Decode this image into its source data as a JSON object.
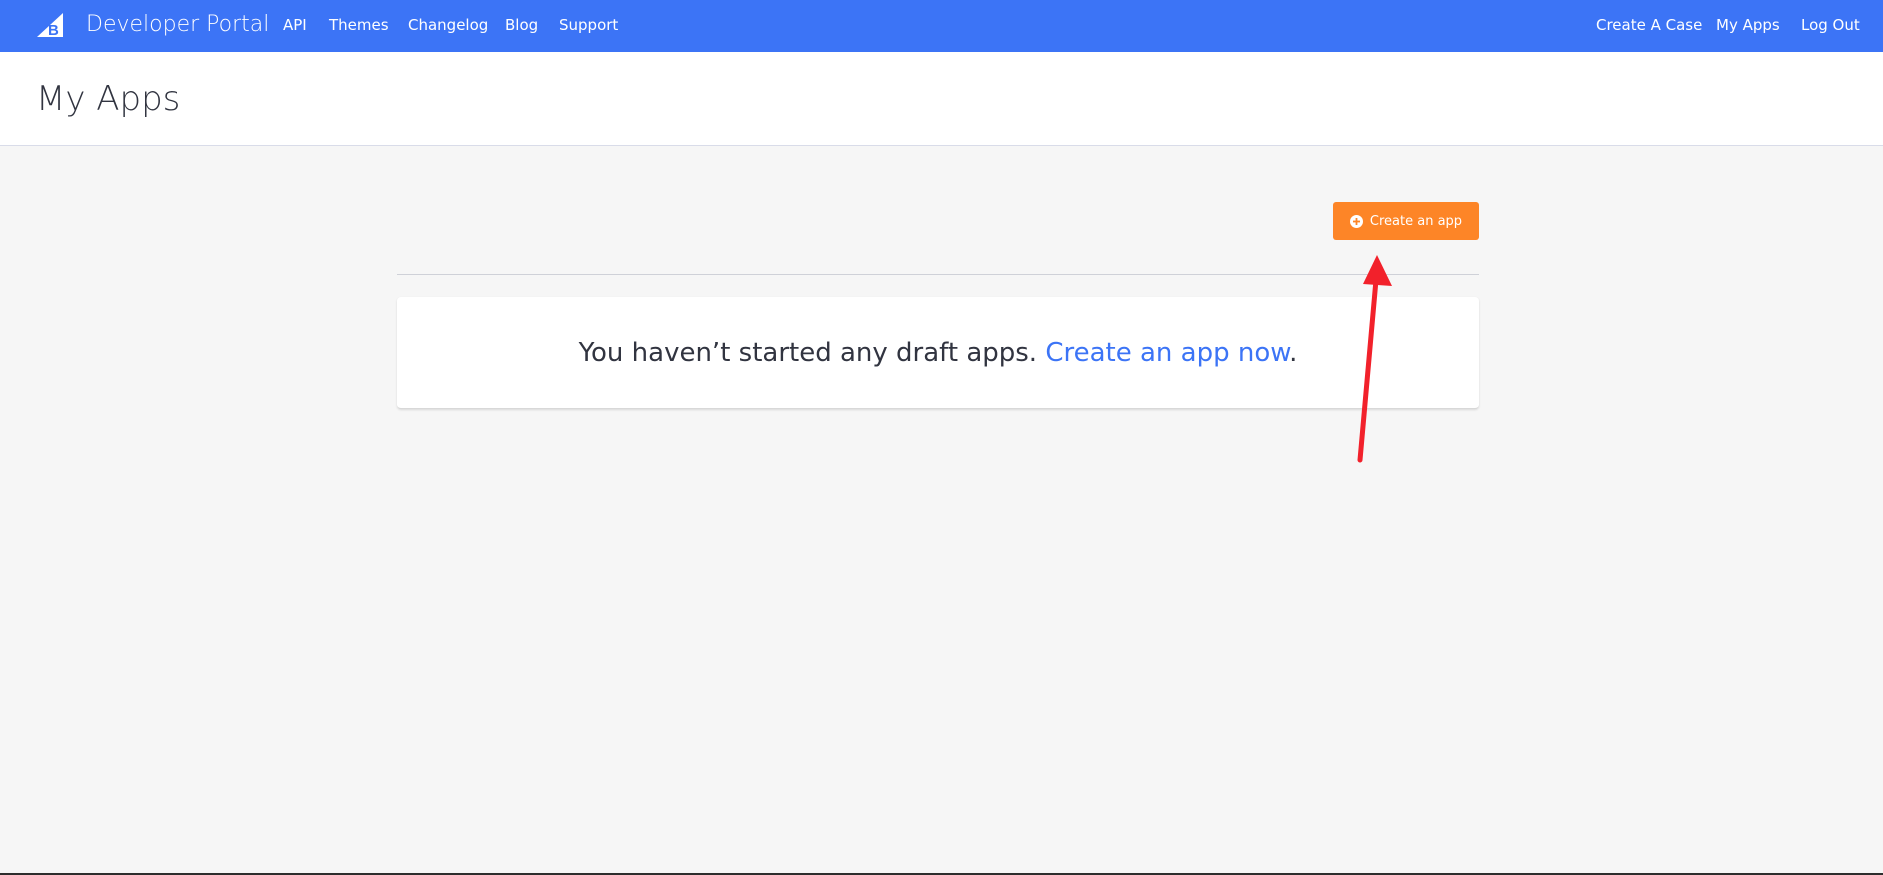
{
  "brand": {
    "name": "Developer Portal",
    "logo_icon": "bigcommerce-b-logo-icon"
  },
  "nav": {
    "left_items": [
      "API",
      "Themes",
      "Changelog",
      "Blog",
      "Support"
    ],
    "right_items": [
      "Create A Case",
      "My Apps",
      "Log Out"
    ]
  },
  "page": {
    "title": "My Apps"
  },
  "toolbar": {
    "create_button_label": "Create an app",
    "create_button_icon": "plus-circle-icon"
  },
  "empty_state": {
    "message": "You haven’t started any draft apps.",
    "link_text": "Create an app now",
    "suffix": "."
  },
  "colors": {
    "nav_background": "#3c74f6",
    "primary_button": "#fd8527",
    "link": "#3c74f6",
    "page_background": "#f6f6f6",
    "annotation_arrow": "#f2212b"
  }
}
